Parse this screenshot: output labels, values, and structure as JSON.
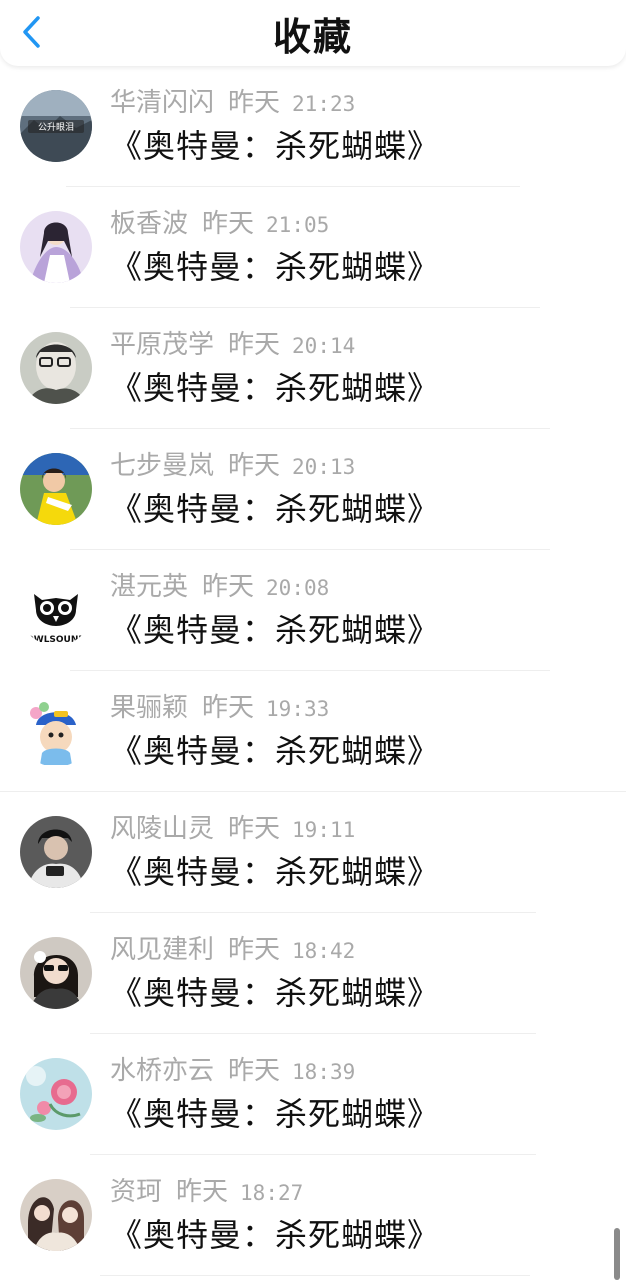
{
  "header": {
    "title": "收藏",
    "back_icon": "chevron-left-icon",
    "accent": "#2196F3"
  },
  "items": [
    {
      "name": "华清闪闪",
      "day": "昨天",
      "time": "21:23",
      "message": "《奥特曼：杀死蝴蝶》",
      "avatar_badge": "公升眼泪"
    },
    {
      "name": "板香波",
      "day": "昨天",
      "time": "21:05",
      "message": "《奥特曼：杀死蝴蝶》"
    },
    {
      "name": "平原茂学",
      "day": "昨天",
      "time": "20:14",
      "message": "《奥特曼：杀死蝴蝶》"
    },
    {
      "name": "七步曼岚",
      "day": "昨天",
      "time": "20:13",
      "message": "《奥特曼：杀死蝴蝶》"
    },
    {
      "name": "湛元英",
      "day": "昨天",
      "time": "20:08",
      "message": "《奥特曼：杀死蝴蝶》",
      "avatar_badge": "OWLSOUND"
    },
    {
      "name": "果骊颖",
      "day": "昨天",
      "time": "19:33",
      "message": "《奥特曼：杀死蝴蝶》"
    },
    {
      "name": "风陵山灵",
      "day": "昨天",
      "time": "19:11",
      "message": "《奥特曼：杀死蝴蝶》"
    },
    {
      "name": "风见建利",
      "day": "昨天",
      "time": "18:42",
      "message": "《奥特曼：杀死蝴蝶》"
    },
    {
      "name": "水桥亦云",
      "day": "昨天",
      "time": "18:39",
      "message": "《奥特曼：杀死蝴蝶》"
    },
    {
      "name": "资珂",
      "day": "昨天",
      "time": "18:27",
      "message": "《奥特曼：杀死蝴蝶》"
    }
  ]
}
